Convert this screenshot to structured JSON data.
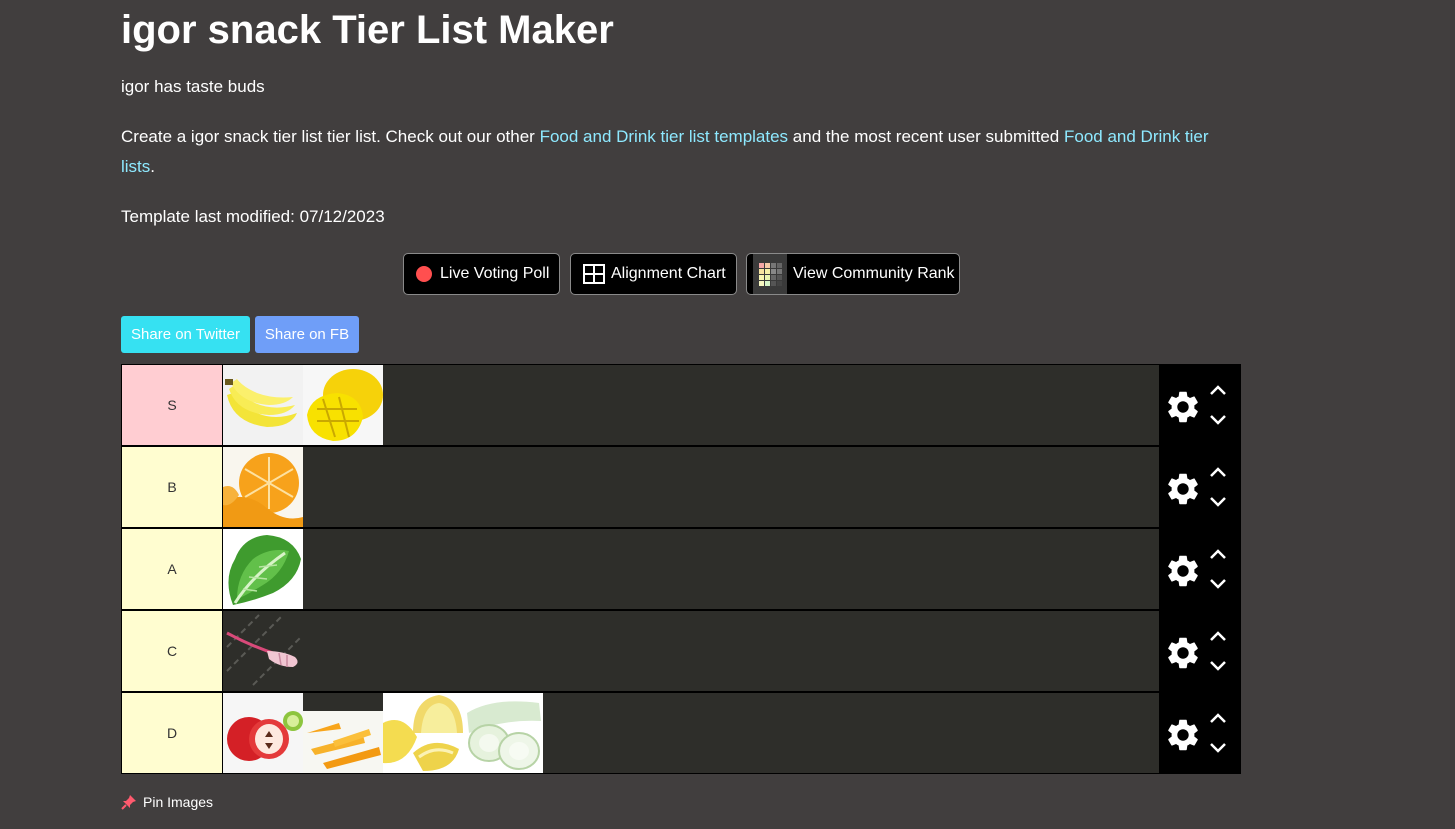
{
  "header": {
    "title": "igor snack Tier List Maker",
    "subtitle": "igor has taste buds"
  },
  "description": {
    "part1": "Create a igor snack tier list tier list. Check out our other ",
    "link1": "Food and Drink tier list templates",
    "part2": " and the most recent user submitted ",
    "link2": "Food and Drink tier lists",
    "part3": "."
  },
  "modified": "Template last modified: 07/12/2023",
  "feature_buttons": {
    "live_poll": "Live Voting Poll",
    "alignment": "Alignment Chart",
    "community": "View Community Rank"
  },
  "share": {
    "twitter": "Share on Twitter",
    "facebook": "Share on FB"
  },
  "tiers": [
    {
      "label": "S",
      "color": "#ffcdd2",
      "items": [
        "banana",
        "mango"
      ]
    },
    {
      "label": "B",
      "color": "#fffdd0",
      "items": [
        "orange"
      ]
    },
    {
      "label": "A",
      "color": "#fffdd0",
      "items": [
        "lettuce"
      ]
    },
    {
      "label": "C",
      "color": "#fffdd0",
      "items": [
        "radish"
      ]
    },
    {
      "label": "D",
      "color": "#fffdd0",
      "items": [
        "apple",
        "carrots",
        "melon",
        "cucumber"
      ]
    }
  ],
  "pin_images": "Pin Images",
  "colors": {
    "background": "#413e3e",
    "link": "#8ee9ff",
    "twitter": "#36e1f2",
    "facebook": "#6f9ef8"
  }
}
